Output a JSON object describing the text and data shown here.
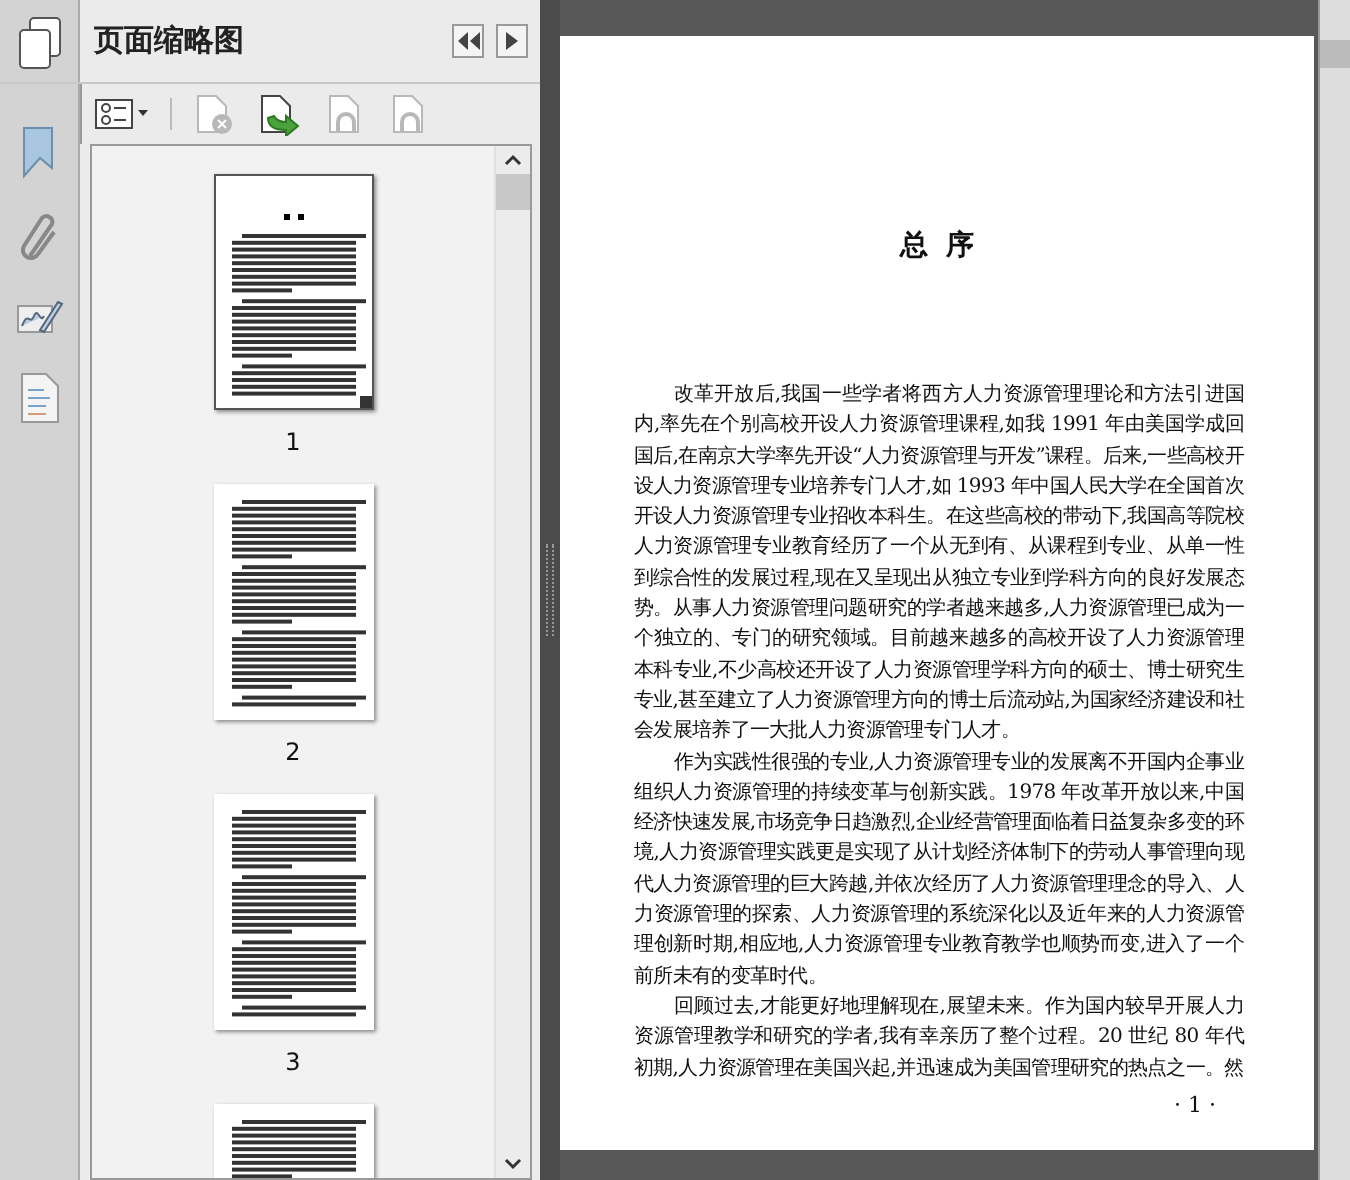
{
  "panel": {
    "title": "页面缩略图"
  },
  "toolbar": [
    {
      "kind": "options",
      "disabled": false
    },
    {
      "kind": "delete",
      "disabled": true
    },
    {
      "kind": "insert",
      "disabled": false
    },
    {
      "kind": "undo",
      "disabled": true
    },
    {
      "kind": "redo",
      "disabled": true
    }
  ],
  "thumbnails": [
    {
      "label": "1",
      "selected": true,
      "kind": "title"
    },
    {
      "label": "2",
      "selected": false,
      "kind": "text"
    },
    {
      "label": "3",
      "selected": false,
      "kind": "text"
    },
    {
      "selected": false,
      "kind": "text"
    }
  ],
  "document": {
    "heading": "总 序",
    "paragraphs": [
      "改革开放后,我国一些学者将西方人力资源管理理论和方法引进国内,率先在个别高校开设人力资源管理课程,如我 1991 年由美国学成回国后,在南京大学率先开设“人力资源管理与开发”课程。后来,一些高校开设人力资源管理专业培养专门人才,如 1993 年中国人民大学在全国首次开设人力资源管理专业招收本科生。在这些高校的带动下,我国高等院校人力资源管理专业教育经历了一个从无到有、从课程到专业、从单一性到综合性的发展过程,现在又呈现出从独立专业到学科方向的良好发展态势。从事人力资源管理问题研究的学者越来越多,人力资源管理已成为一个独立的、专门的研究领域。目前越来越多的高校开设了人力资源管理本科专业,不少高校还开设了人力资源管理学科方向的硕士、博士研究生专业,甚至建立了人力资源管理方向的博士后流动站,为国家经济建设和社会发展培养了一大批人力资源管理专门人才。",
      "作为实践性很强的专业,人力资源管理专业的发展离不开国内企事业组织人力资源管理的持续变革与创新实践。1978 年改革开放以来,中国经济快速发展,市场竞争日趋激烈,企业经营管理面临着日益复杂多变的环境,人力资源管理实践更是实现了从计划经济体制下的劳动人事管理向现代人力资源管理的巨大跨越,并依次经历了人力资源管理理念的导入、人力资源管理的探索、人力资源管理的系统深化以及近年来的人力资源管理创新时期,相应地,人力资源管理专业教育教学也顺势而变,进入了一个前所未有的变革时代。",
      "回顾过去,才能更好地理解现在,展望未来。作为国内较早开展人力资源管理教学和研究的学者,我有幸亲历了整个过程。20 世纪 80 年代初期,人力资源管理在美国兴起,并迅速成为美国管理研究的热点之一。然"
    ],
    "page_number": "· 1 ·"
  }
}
